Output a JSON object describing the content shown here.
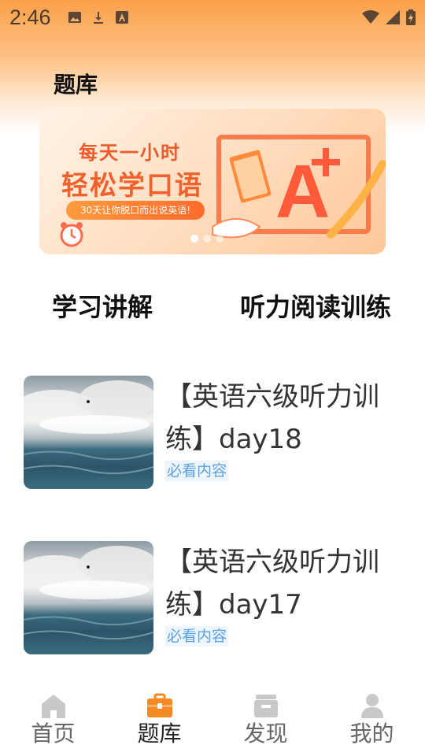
{
  "status_bar": {
    "time": "2:46",
    "left_icons": [
      "image-icon",
      "download-icon",
      "a-icon"
    ],
    "right_icons": [
      "wifi-icon",
      "signal-icon",
      "battery-icon"
    ]
  },
  "page": {
    "title": "题库"
  },
  "banner": {
    "line1": "每天一小时",
    "line2": "轻松学口语",
    "pill": "30天让你脱口而出说英语!",
    "slides": 3,
    "active_slide": 1
  },
  "categories": [
    {
      "label": "学习讲解"
    },
    {
      "label": "听力阅读训练"
    }
  ],
  "list": [
    {
      "title": "【英语六级听力训练】day18",
      "tag": "必看内容"
    },
    {
      "title": "【英语六级听力训练】day17",
      "tag": "必看内容"
    }
  ],
  "tabbar": {
    "tabs": [
      {
        "label": "首页",
        "icon": "home-icon",
        "active": false
      },
      {
        "label": "题库",
        "icon": "briefcase-icon",
        "active": true
      },
      {
        "label": "发现",
        "icon": "inbox-icon",
        "active": false
      },
      {
        "label": "我的",
        "icon": "person-icon",
        "active": false
      }
    ]
  },
  "colors": {
    "accent": "#f58a22",
    "tag_text": "#5aa3e6",
    "inactive_icon": "#c8c8c8"
  }
}
